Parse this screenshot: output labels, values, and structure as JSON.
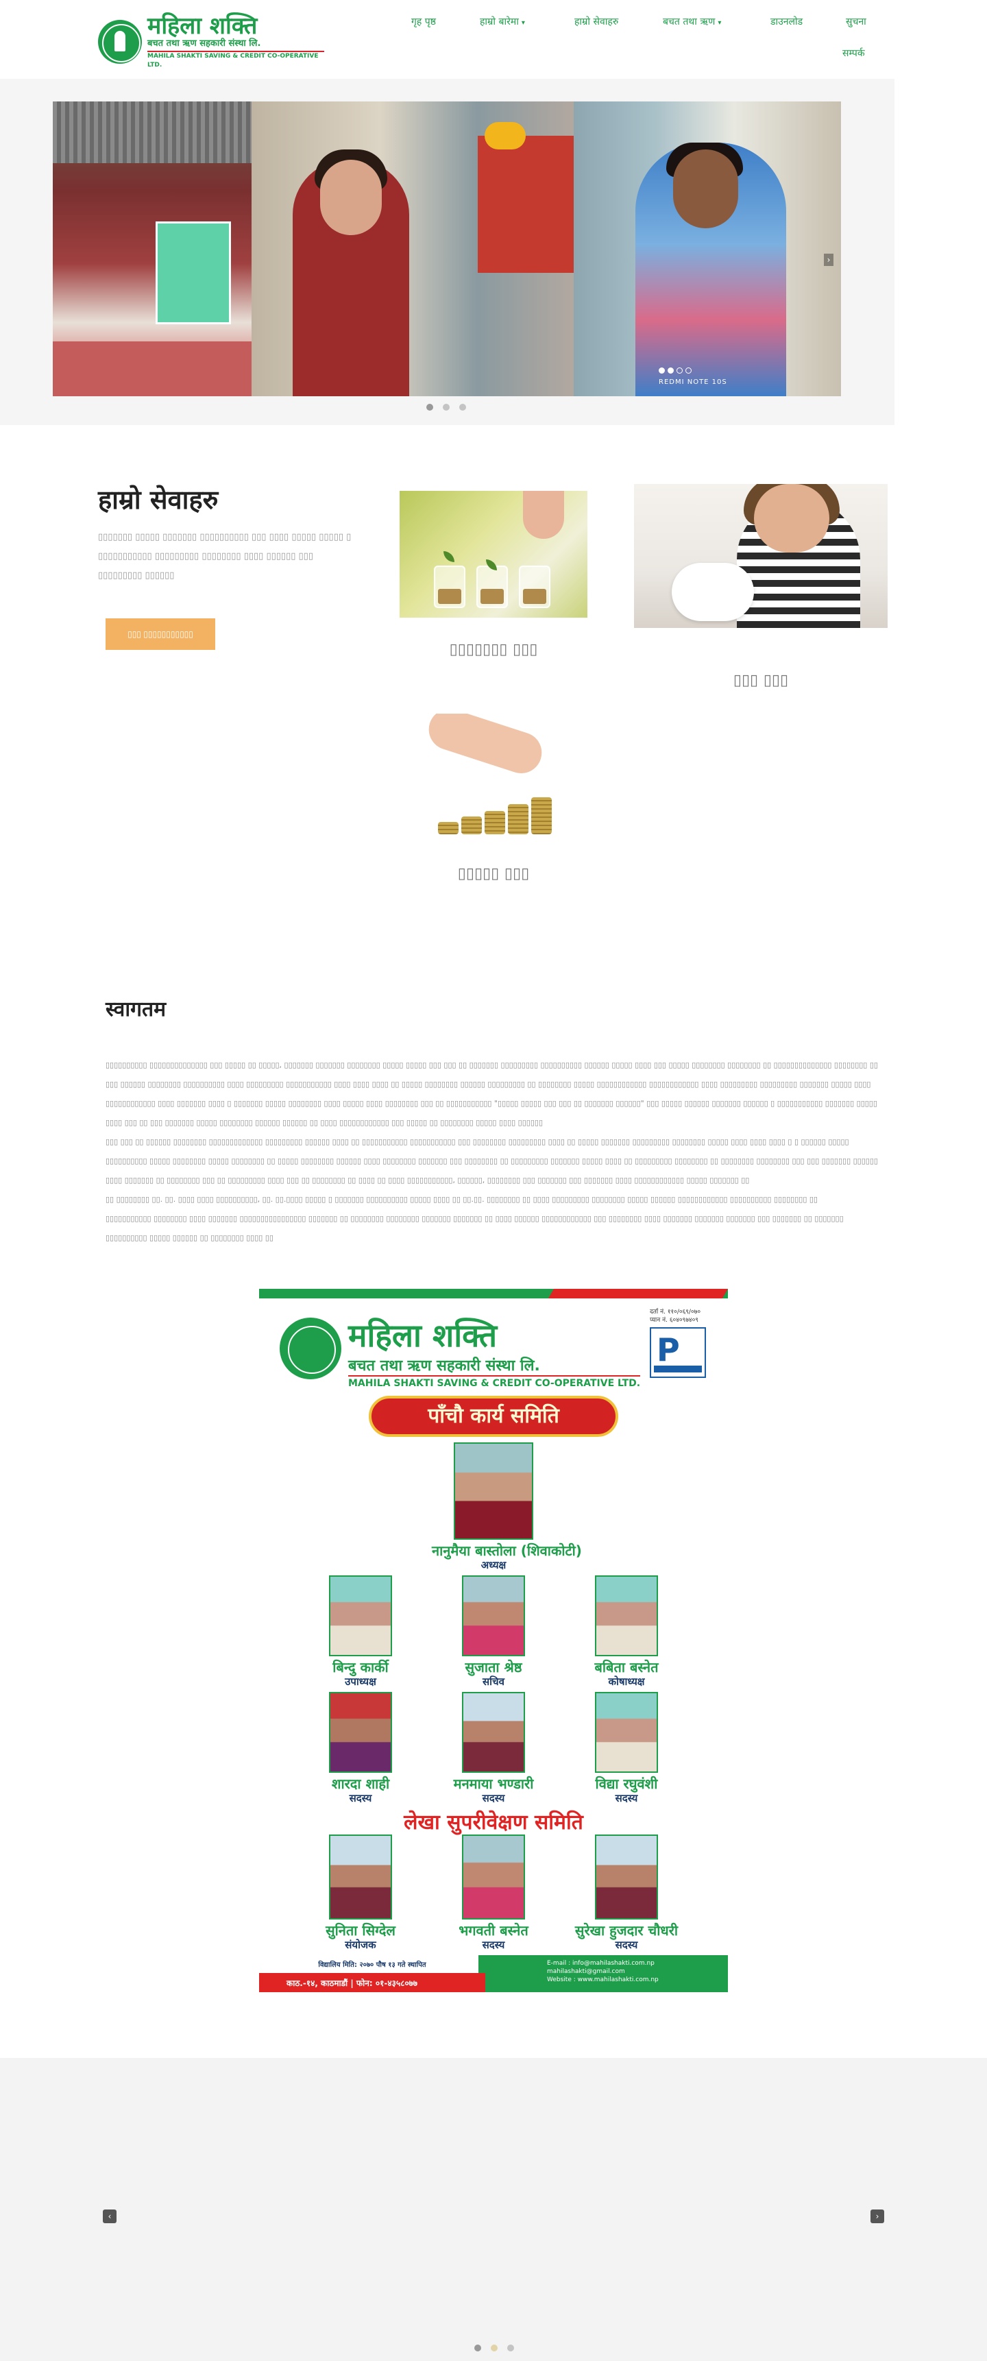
{
  "header": {
    "logo": {
      "title": "महिला शक्ति",
      "subtitle": "बचत तथा ऋण सहकारी संस्था लि.",
      "english": "MAHILA SHAKTI SAVING & CREDIT CO-OPERATIVE LTD."
    },
    "nav": [
      {
        "label": "गृह पृष्ठ",
        "dropdown": false
      },
      {
        "label": "हाम्रो बारेमा",
        "dropdown": true
      },
      {
        "label": "हाम्रो सेवाहरु",
        "dropdown": false
      },
      {
        "label": "बचत तथा ऋण",
        "dropdown": true
      },
      {
        "label": "डाउनलोड",
        "dropdown": false
      },
      {
        "label": "सुचना",
        "dropdown": false
      },
      {
        "label": "सम्पर्क",
        "dropdown": false
      }
    ]
  },
  "slider": {
    "caption": "REDMI NOTE 10S",
    "inner_dots": 4,
    "active_inner_dot": 1,
    "dots": 3,
    "active_dot": 0
  },
  "services": {
    "title": "हाम्रो सेवाहरु",
    "description": "▯▯▯▯▯▯▯ ▯▯▯▯▯ ▯▯▯▯▯▯▯ ▯▯▯▯▯▯▯▯▯▯ ▯▯▯ ▯▯▯▯ ▯▯▯▯▯ ▯▯▯▯▯ ▯ ▯▯▯▯▯▯▯▯▯▯▯ ▯▯▯▯▯▯▯▯▯ ▯▯▯▯▯▯▯▯ ▯▯▯▯ ▯▯▯▯▯▯  ▯▯▯ ▯▯▯▯▯▯▯▯▯ ▯▯▯▯▯▯",
    "button_label": "▯▯▯ ▯▯▯▯▯▯▯▯▯▯▯",
    "cards": [
      {
        "title": "▯▯▯▯▯▯▯ ▯▯▯"
      },
      {
        "title": "▯▯▯ ▯▯▯"
      },
      {
        "title": "▯▯▯▯▯ ▯▯▯"
      }
    ]
  },
  "welcome": {
    "title": "स्वागतम",
    "paragraphs": [
      "▯▯▯▯▯▯▯▯▯▯ ▯▯▯▯▯▯▯▯▯▯▯▯▯▯ ▯▯▯ ▯▯▯▯▯ ▯▯ ▯▯▯▯▯, ▯▯▯▯▯▯▯ ▯▯▯▯▯▯▯ ▯▯▯▯▯▯▯▯ ▯▯▯▯▯ ▯▯▯▯▯ ▯▯▯ ▯▯▯ ▯▯ ▯▯▯▯▯▯▯ ▯▯▯▯▯▯▯▯▯ ▯▯▯▯▯▯▯▯▯▯ ▯▯▯▯▯▯ ▯▯▯▯▯ ▯▯▯▯ ▯▯▯ ▯▯▯▯▯ ▯▯▯▯▯▯▯▯ ▯▯▯▯▯▯▯▯ ▯▯ ▯▯▯▯▯▯▯▯▯▯▯▯▯▯ ▯▯▯▯▯▯▯▯ ▯▯ ▯▯▯ ▯▯▯▯▯▯ ▯▯▯▯▯▯▯▯ ▯▯▯▯▯▯▯▯▯▯ ▯▯▯▯ ▯▯▯▯▯▯▯▯▯ ▯▯▯▯▯▯▯▯▯▯▯ ▯▯▯▯ ▯▯▯▯ ▯▯▯▯ ▯▯ ▯▯▯▯▯ ▯▯▯▯▯▯▯▯ ▯▯▯▯▯▯ ▯▯▯▯▯▯▯▯▯ ▯▯ ▯▯▯▯▯▯▯▯ ▯▯▯▯▯ ▯▯▯▯▯▯▯▯▯▯▯▯ ▯▯▯▯▯▯▯▯▯▯▯▯ ▯▯▯▯ ▯▯▯▯▯▯▯▯▯ ▯▯▯▯▯▯▯▯▯ ▯▯▯▯▯▯▯ ▯▯▯▯▯ ▯▯▯▯ ▯▯▯▯▯▯▯▯▯▯▯▯ ▯▯▯▯ ▯▯▯▯▯▯▯ ▯▯▯▯ ▯ ▯▯▯▯▯▯▯ ▯▯▯▯▯ ▯▯▯▯▯▯▯▯ ▯▯▯▯ ▯▯▯▯▯ ▯▯▯▯ ▯▯▯▯▯▯▯▯ ▯▯▯ ▯▯ ▯▯▯▯▯▯▯▯▯▯▯ \"▯▯▯▯▯ ▯▯▯▯▯ ▯▯▯ ▯▯▯ ▯▯ ▯▯▯▯▯▯▯ ▯▯▯▯▯▯\" ▯▯▯ ▯▯▯▯▯ ▯▯▯▯▯▯ ▯▯▯▯▯▯▯ ▯▯▯▯▯▯ ▯ ▯▯▯▯▯▯▯▯▯▯▯ ▯▯▯▯▯▯▯ ▯▯▯▯▯ ▯▯▯▯ ▯▯▯ ▯▯ ▯▯▯ ▯▯▯▯▯▯▯ ▯▯▯▯▯ ▯▯▯▯▯▯▯▯ ▯▯▯▯▯▯ ▯▯▯▯▯▯ ▯▯ ▯▯▯▯ ▯▯▯▯▯▯▯▯▯▯▯▯ ▯▯▯ ▯▯▯▯▯ ▯▯ ▯▯▯▯▯▯▯▯ ▯▯▯▯▯ ▯▯▯▯ ▯▯▯▯▯▯",
      "▯▯▯ ▯▯▯ ▯▯ ▯▯▯▯▯▯ ▯▯▯▯▯▯▯▯ ▯▯▯▯▯▯▯▯▯▯▯▯▯ ▯▯▯▯▯▯▯▯▯ ▯▯▯▯▯▯ ▯▯▯▯ ▯▯ ▯▯▯▯▯▯▯▯▯▯▯ ▯▯▯▯▯▯▯▯▯▯▯ ▯▯▯ ▯▯▯▯▯▯▯▯ ▯▯▯▯▯▯▯▯▯ ▯▯▯▯ ▯▯ ▯▯▯▯▯ ▯▯▯▯▯▯▯ ▯▯▯▯▯▯▯▯▯ ▯▯▯▯▯▯▯▯ ▯▯▯▯▯ ▯▯▯▯ ▯▯▯▯ ▯▯▯▯ ▯ ▯ ▯▯▯▯▯▯ ▯▯▯▯▯ ▯▯▯▯▯▯▯▯▯▯ ▯▯▯▯▯ ▯▯▯▯▯▯▯▯ ▯▯▯▯▯ ▯▯▯▯▯▯▯▯ ▯▯ ▯▯▯▯▯ ▯▯▯▯▯▯▯▯ ▯▯▯▯▯▯ ▯▯▯▯ ▯▯▯▯▯▯▯▯ ▯▯▯▯▯▯▯ ▯▯▯ ▯▯▯▯▯▯▯▯ ▯▯ ▯▯▯▯▯▯▯▯▯ ▯▯▯▯▯▯▯ ▯▯▯▯▯ ▯▯▯▯ ▯▯ ▯▯▯▯▯▯▯▯▯ ▯▯▯▯▯▯▯▯ ▯▯ ▯▯▯▯▯▯▯▯ ▯▯▯▯▯▯▯▯ ▯▯▯ ▯▯▯ ▯▯▯▯▯▯▯ ▯▯▯▯▯▯ ▯▯▯▯ ▯▯▯▯▯▯▯ ▯▯ ▯▯▯▯▯▯▯▯ ▯▯▯ ▯▯ ▯▯▯▯▯▯▯▯▯ ▯▯▯▯ ▯▯▯ ▯▯ ▯▯▯▯▯▯▯▯ ▯▯ ▯▯▯▯ ▯▯ ▯▯▯▯ ▯▯▯▯▯▯▯▯▯▯▯, ▯▯▯▯▯▯, ▯▯▯▯▯▯▯▯ ▯▯▯ ▯▯▯▯▯▯▯ ▯▯▯ ▯▯▯▯▯▯▯ ▯▯▯▯ ▯▯▯▯▯▯▯▯▯▯▯▯ ▯▯▯▯▯ ▯▯▯▯▯▯▯ ▯▯",
      "▯▯ ▯▯▯▯▯▯▯▯ ▯▯. ▯▯. ▯▯▯▯ ▯▯▯▯ ▯▯▯▯▯▯▯▯▯▯, ▯▯. ▯▯.▯▯▯▯ ▯▯▯▯▯ ▯ ▯▯▯▯▯▯▯ ▯▯▯▯▯▯▯▯▯▯ ▯▯▯▯▯ ▯▯▯▯ ▯▯ ▯▯.▯▯. ▯▯▯▯▯▯▯▯ ▯▯ ▯▯▯▯ ▯▯▯▯▯▯▯▯▯ ▯▯▯▯▯▯▯▯ ▯▯▯▯▯ ▯▯▯▯▯▯ ▯▯▯▯▯▯▯▯▯▯▯▯ ▯▯▯▯▯▯▯▯▯▯ ▯▯▯▯▯▯▯▯ ▯▯",
      "▯▯▯▯▯▯▯▯▯▯▯ ▯▯▯▯▯▯▯▯ ▯▯▯▯ ▯▯▯▯▯▯▯ ▯▯▯▯▯▯▯▯▯▯▯▯▯▯▯▯ ▯▯▯▯▯▯▯ ▯▯ ▯▯▯▯▯▯▯▯ ▯▯▯▯▯▯▯▯ ▯▯▯▯▯▯▯ ▯▯▯▯▯▯▯ ▯▯ ▯▯▯▯ ▯▯▯▯▯▯ ▯▯▯▯▯▯▯▯▯▯▯▯ ▯▯▯ ▯▯▯▯▯▯▯▯ ▯▯▯▯ ▯▯▯▯▯▯▯ ▯▯▯▯▯▯▯ ▯▯▯▯▯▯▯ ▯▯▯ ▯▯▯▯▯▯▯ ▯▯ ▯▯▯▯▯▯▯ ▯▯▯▯▯▯▯▯▯▯ ▯▯▯▯▯ ▯▯▯▯▯▯ ▯▯ ▯▯▯▯▯▯▯▯ ▯▯▯▯ ▯▯"
    ]
  },
  "committee": {
    "poster_title": "महिला शक्ति",
    "poster_subtitle": "बचत तथा ऋण सहकारी संस्था लि.",
    "poster_english": "MAHILA SHAKTI SAVING & CREDIT CO-OPERATIVE LTD.",
    "reg_no": "दर्ता नं. ११०/०६९/०७०",
    "pan_no": "प्यान नं. ६०४०९७४०९",
    "banner": "पाँचौ कार्य समिति",
    "chair": {
      "name": "नानुमैया बास्तोला (शिवाकोटी)",
      "role": "अध्यक्ष"
    },
    "row1": [
      {
        "name": "बिन्दु कार्की",
        "role": "उपाध्यक्ष"
      },
      {
        "name": "सुजाता श्रेष्ठ",
        "role": "सचिव"
      },
      {
        "name": "बबिता बस्नेत",
        "role": "कोषाध्यक्ष"
      }
    ],
    "row2": [
      {
        "name": "शारदा शाही",
        "role": "सदस्य"
      },
      {
        "name": "मनमाया भण्डारी",
        "role": "सदस्य"
      },
      {
        "name": "विद्या रघुवंशी",
        "role": "सदस्य"
      }
    ],
    "audit_title": "लेखा सुपरीवेक्षण समिति",
    "audit": [
      {
        "name": "सुनिता सिग्देल",
        "role": "संयोजक"
      },
      {
        "name": "भगवती बस्नेत",
        "role": "सदस्य"
      },
      {
        "name": "सुरेखा हुजदार चौधरी",
        "role": "सदस्य"
      }
    ],
    "footer_regdate": "विद्यालिय मिति: २०७० पौष १३ गते स्थापित",
    "footer_address": "काठ.-१४, काठमाडौं | फोन: ०१-४३५८०७७",
    "footer_email": "E-mail : info@mahilashakti.com.np",
    "footer_email2": "mahilashakti@gmail.com",
    "footer_website": "Website : www.mahilashakti.com.np"
  },
  "bottom_slider": {
    "prev": "‹",
    "next": "›",
    "dots": 3,
    "active_dot": 0
  },
  "colors": {
    "brand_green": "#1e9e4a",
    "accent_orange": "#f2b261",
    "brand_red": "#e02424"
  }
}
